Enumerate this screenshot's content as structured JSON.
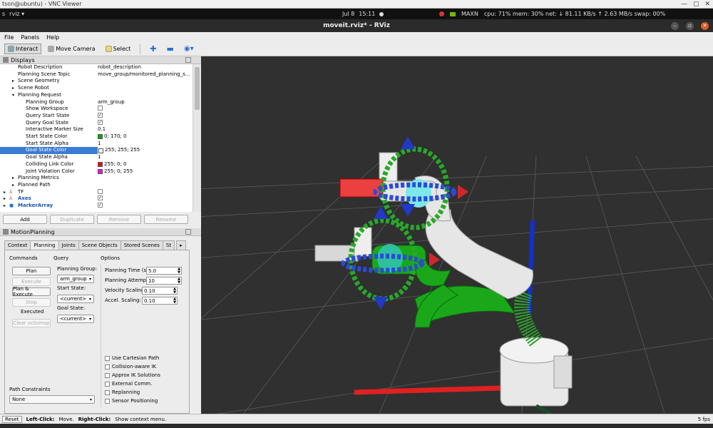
{
  "vnc": {
    "title": "tson@ubuntu) - VNC Viewer"
  },
  "topbar": {
    "app": "rviz ▾",
    "date": "Jul 8",
    "time": "15:11",
    "maxn": "MAXN",
    "stats": "cpu: 71% mem: 30% net: ↓ 81.11 KB/s ↑ 2.63 MB/s swap: 00%"
  },
  "window": {
    "title": "moveit.rviz* - RViz"
  },
  "menu": {
    "file": "File",
    "panels": "Panels",
    "help": "Help"
  },
  "toolbar": {
    "interact": "Interact",
    "move_camera": "Move Camera",
    "select": "Select"
  },
  "displays": {
    "title": "Displays",
    "rows": [
      {
        "key": "Robot Description",
        "value": "robot_description"
      },
      {
        "key": "Planning Scene Topic",
        "value": "move_group/monitored_planning_s..."
      },
      {
        "key": "Scene Geometry",
        "value": ""
      },
      {
        "key": "Scene Robot",
        "value": ""
      },
      {
        "key": "Planning Request",
        "value": ""
      },
      {
        "key": "Planning Group",
        "value": "arm_group"
      },
      {
        "key": "Show Workspace",
        "value": ""
      },
      {
        "key": "Query Start State",
        "value": ""
      },
      {
        "key": "Query Goal State",
        "value": ""
      },
      {
        "key": "Interactive Marker Size",
        "value": "0.1"
      },
      {
        "key": "Start State Color",
        "value": "0; 170; 0"
      },
      {
        "key": "Start State Alpha",
        "value": "1"
      },
      {
        "key": "Goal State Color",
        "value": "255; 255; 255"
      },
      {
        "key": "Goal State Alpha",
        "value": "1"
      },
      {
        "key": "Colliding Link Color",
        "value": "255; 0; 0"
      },
      {
        "key": "Joint Violation Color",
        "value": "255; 0; 255"
      },
      {
        "key": "Planning Metrics",
        "value": ""
      },
      {
        "key": "Planned Path",
        "value": ""
      },
      {
        "key": "TF",
        "value": ""
      },
      {
        "key": "Axes",
        "value": ""
      },
      {
        "key": "MarkerArray",
        "value": ""
      }
    ],
    "buttons": {
      "add": "Add",
      "duplicate": "Duplicate",
      "remove": "Remove",
      "rename": "Rename"
    }
  },
  "motion_planning": {
    "title": "MotionPlanning",
    "tabs": [
      "Context",
      "Planning",
      "Joints",
      "Scene Objects",
      "Stored Scenes",
      "St"
    ],
    "commands_label": "Commands",
    "query_label": "Query",
    "options_label": "Options",
    "plan": "Plan",
    "execute": "Execute",
    "plan_execute": "Plan & Execute",
    "stop": "Stop",
    "executed": "Executed",
    "clear_octomap": "Clear octomap",
    "planning_group_label": "Planning Group:",
    "planning_group_value": "arm_group",
    "start_state_label": "Start State:",
    "start_state_value": "<current>",
    "goal_state_label": "Goal State:",
    "goal_state_value": "<current>",
    "planning_time_label": "Planning Time (s):",
    "planning_time": "5.0",
    "planning_attempts_label": "Planning Attempts:",
    "planning_attempts": "10",
    "velocity_scaling_label": "Velocity Scaling:",
    "velocity_scaling": "0.10",
    "accel_scaling_label": "Accel. Scaling:",
    "accel_scaling": "0.10",
    "checkboxes": [
      "Use Cartesian Path",
      "Collision-aware IK",
      "Approx IK Solutions",
      "External Comm.",
      "Replanning",
      "Sensor Positioning"
    ],
    "path_constraints_label": "Path Constraints",
    "path_constraints_value": "None"
  },
  "status": {
    "reset": "Reset",
    "left_click": "Left-Click:",
    "left_click_desc": "Move.",
    "right_click": "Right-Click:",
    "right_click_desc": "Show context menu.",
    "fps": "5 fps"
  },
  "colors": {
    "start_state": "#00aa00",
    "goal_state": "#ffffff",
    "colliding": "#ff0000",
    "joint_violation": "#ff00ff",
    "selection": "#3a7bd5",
    "viewport_bg": "#303030"
  }
}
